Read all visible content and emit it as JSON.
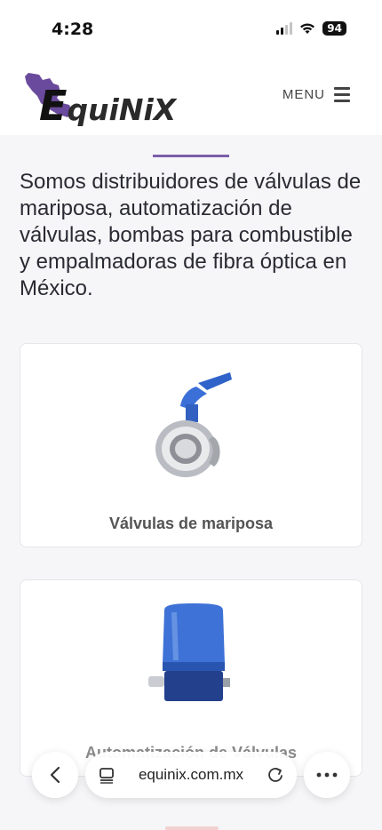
{
  "status": {
    "time": "4:28",
    "battery": "94"
  },
  "header": {
    "logo_text": "quiNiX",
    "logo_initial": "E",
    "menu_label": "MENU"
  },
  "main": {
    "intro": "Somos distribuidores de válvulas de mariposa, automatización de válvulas, bombas para combustible y empalmadoras de fibra óptica en México.",
    "cards": [
      {
        "title": "Válvulas de mariposa"
      },
      {
        "title": "Automatización de Válvulas"
      }
    ]
  },
  "browser": {
    "url": "equinix.com.mx"
  },
  "colors": {
    "accent": "#7b5ea8",
    "valve_blue": "#2f63c9"
  }
}
